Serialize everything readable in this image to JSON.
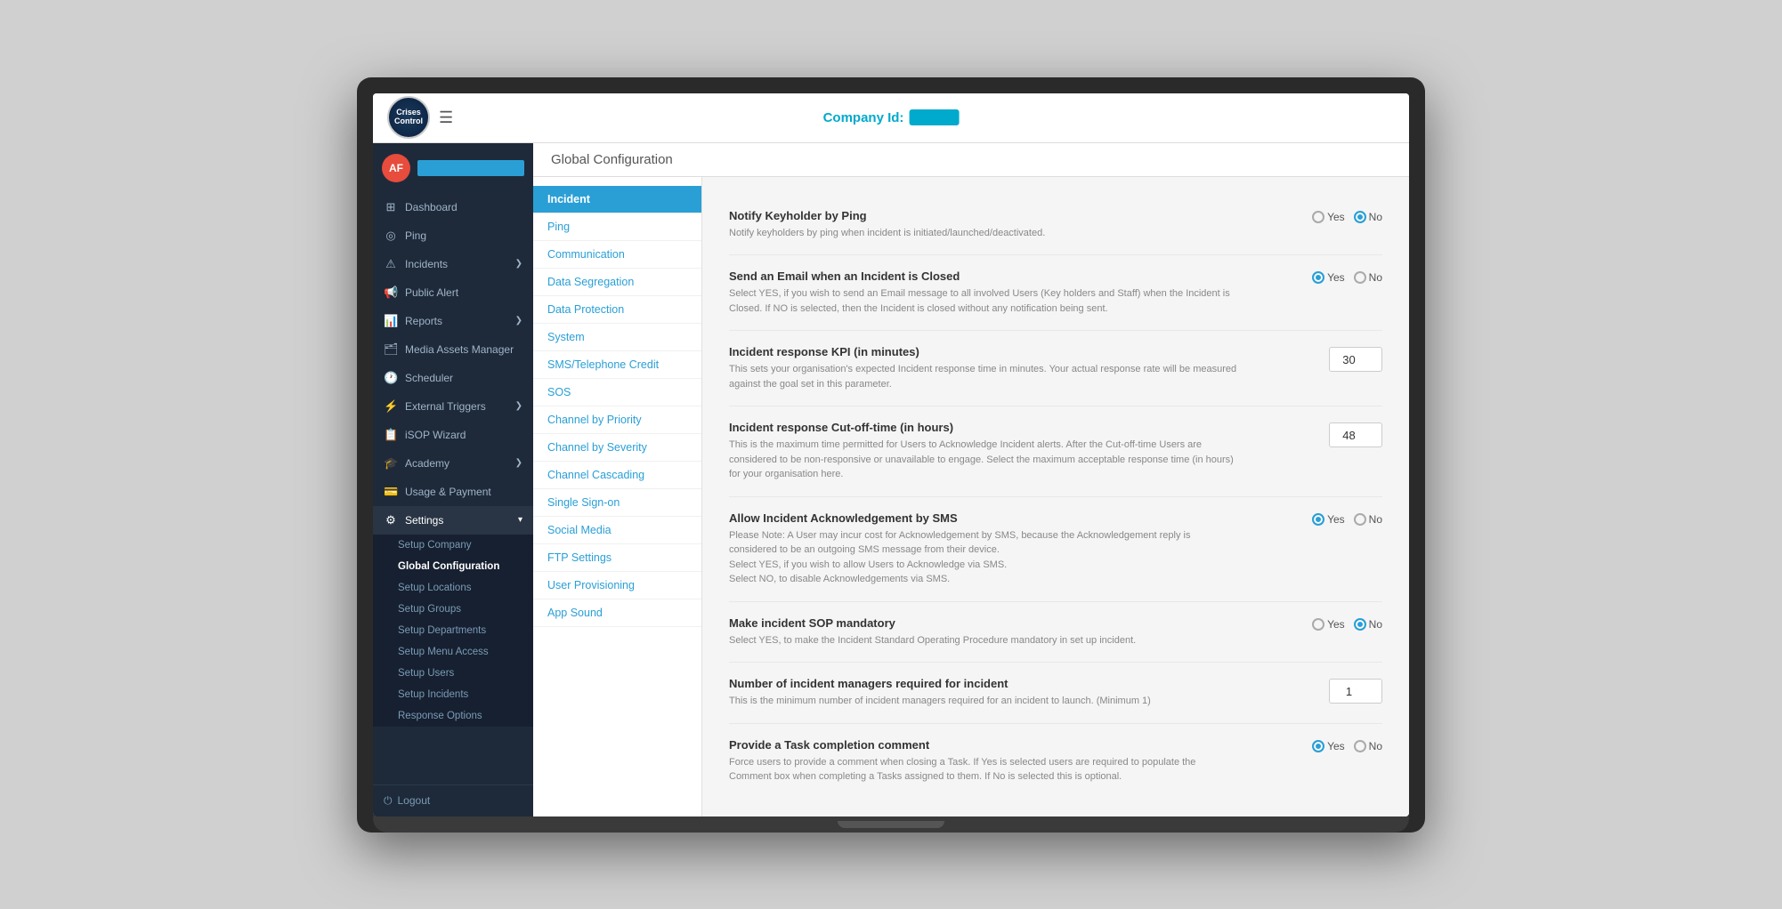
{
  "header": {
    "company_label": "Company Id:",
    "company_value": "██████████",
    "hamburger_label": "☰"
  },
  "logo": {
    "text": "Crises\nControl"
  },
  "user": {
    "initials": "AF"
  },
  "sidebar": {
    "items": [
      {
        "id": "dashboard",
        "label": "Dashboard",
        "icon": "⊞"
      },
      {
        "id": "ping",
        "label": "Ping",
        "icon": "◉"
      },
      {
        "id": "incidents",
        "label": "Incidents",
        "icon": "⚠",
        "arrow": "❯"
      },
      {
        "id": "public-alert",
        "label": "Public Alert",
        "icon": "📢"
      },
      {
        "id": "reports",
        "label": "Reports",
        "icon": "📊",
        "arrow": "❯"
      },
      {
        "id": "media-assets",
        "label": "Media Assets Manager",
        "icon": "🗂"
      },
      {
        "id": "scheduler",
        "label": "Scheduler",
        "icon": "🕐"
      },
      {
        "id": "external-triggers",
        "label": "External Triggers",
        "icon": "⚡",
        "arrow": "❯"
      },
      {
        "id": "isop-wizard",
        "label": "iSOP Wizard",
        "icon": "📋"
      },
      {
        "id": "academy",
        "label": "Academy",
        "icon": "🎓",
        "arrow": "❯"
      },
      {
        "id": "usage-payment",
        "label": "Usage & Payment",
        "icon": "💳"
      },
      {
        "id": "settings",
        "label": "Settings",
        "icon": "⚙",
        "arrow": "▾",
        "active": true
      }
    ],
    "settings_sub": [
      {
        "id": "setup-company",
        "label": "Setup Company"
      },
      {
        "id": "global-configuration",
        "label": "Global Configuration",
        "active": true
      },
      {
        "id": "setup-locations",
        "label": "Setup Locations"
      },
      {
        "id": "setup-groups",
        "label": "Setup Groups"
      },
      {
        "id": "setup-departments",
        "label": "Setup Departments"
      },
      {
        "id": "setup-menu-access",
        "label": "Setup Menu Access"
      },
      {
        "id": "setup-users",
        "label": "Setup Users"
      },
      {
        "id": "setup-incidents",
        "label": "Setup Incidents"
      },
      {
        "id": "response-options",
        "label": "Response Options"
      }
    ],
    "logout": "Logout"
  },
  "page_title": "Global Configuration",
  "config_submenu": [
    {
      "id": "incident",
      "label": "Incident",
      "active": true
    },
    {
      "id": "ping",
      "label": "Ping"
    },
    {
      "id": "communication",
      "label": "Communication"
    },
    {
      "id": "data-segregation",
      "label": "Data Segregation"
    },
    {
      "id": "data-protection",
      "label": "Data Protection"
    },
    {
      "id": "system",
      "label": "System"
    },
    {
      "id": "sms-credit",
      "label": "SMS/Telephone Credit"
    },
    {
      "id": "sos",
      "label": "SOS"
    },
    {
      "id": "channel-priority",
      "label": "Channel by Priority"
    },
    {
      "id": "channel-severity",
      "label": "Channel by Severity"
    },
    {
      "id": "channel-cascading",
      "label": "Channel Cascading"
    },
    {
      "id": "single-signon",
      "label": "Single Sign-on"
    },
    {
      "id": "social-media",
      "label": "Social Media"
    },
    {
      "id": "ftp-settings",
      "label": "FTP Settings"
    },
    {
      "id": "user-provisioning",
      "label": "User Provisioning"
    },
    {
      "id": "app-sound",
      "label": "App Sound"
    }
  ],
  "config_rows": [
    {
      "id": "notify-keyholder",
      "title": "Notify Keyholder by Ping",
      "description": "Notify keyholders by ping when incident is initiated/launched/deactivated.",
      "control_type": "radio",
      "yes_selected": false,
      "no_selected": true
    },
    {
      "id": "email-closed",
      "title": "Send an Email when an Incident is Closed",
      "description": "Select YES, if you wish to send an Email message to all involved Users (Key holders and Staff) when the Incident is Closed. If NO is selected, then the Incident is closed without any notification being sent.",
      "control_type": "radio",
      "yes_selected": true,
      "no_selected": false
    },
    {
      "id": "response-kpi",
      "title": "Incident response KPI (in minutes)",
      "description": "This sets your organisation's expected Incident response time in minutes. Your actual response rate will be measured against the goal set in this parameter.",
      "control_type": "number",
      "value": "30"
    },
    {
      "id": "cutoff-time",
      "title": "Incident response Cut-off-time (in hours)",
      "description": "This is the maximum time permitted for Users to Acknowledge Incident alerts. After the Cut-off-time Users are considered to be non-responsive or unavailable to engage. Select the maximum acceptable response time (in hours) for your organisation here.",
      "control_type": "number",
      "value": "48"
    },
    {
      "id": "ack-sms",
      "title": "Allow Incident Acknowledgement by SMS",
      "description": "Please Note: A User may incur cost for Acknowledgement by SMS, because the Acknowledgement reply is considered to be an outgoing SMS message from their device.\nSelect YES, if you wish to allow Users to Acknowledge via SMS.\nSelect NO, to disable Acknowledgements via SMS.",
      "control_type": "radio",
      "yes_selected": true,
      "no_selected": false
    },
    {
      "id": "sop-mandatory",
      "title": "Make incident SOP mandatory",
      "description": "Select YES, to make the Incident Standard Operating Procedure mandatory in set up incident.",
      "control_type": "radio",
      "yes_selected": false,
      "no_selected": true
    },
    {
      "id": "managers-required",
      "title": "Number of incident managers required for incident",
      "description": "This is the minimum number of incident managers required for an incident to launch. (Minimum 1)",
      "control_type": "number",
      "value": "1"
    },
    {
      "id": "task-comment",
      "title": "Provide a Task completion comment",
      "description": "Force users to provide a comment when closing a Task. If Yes is selected users are required to populate the Comment box when completing a Tasks assigned to them. If No is selected this is optional.",
      "control_type": "radio",
      "yes_selected": true,
      "no_selected": false
    }
  ],
  "radio_labels": {
    "yes": "Yes",
    "no": "No"
  }
}
